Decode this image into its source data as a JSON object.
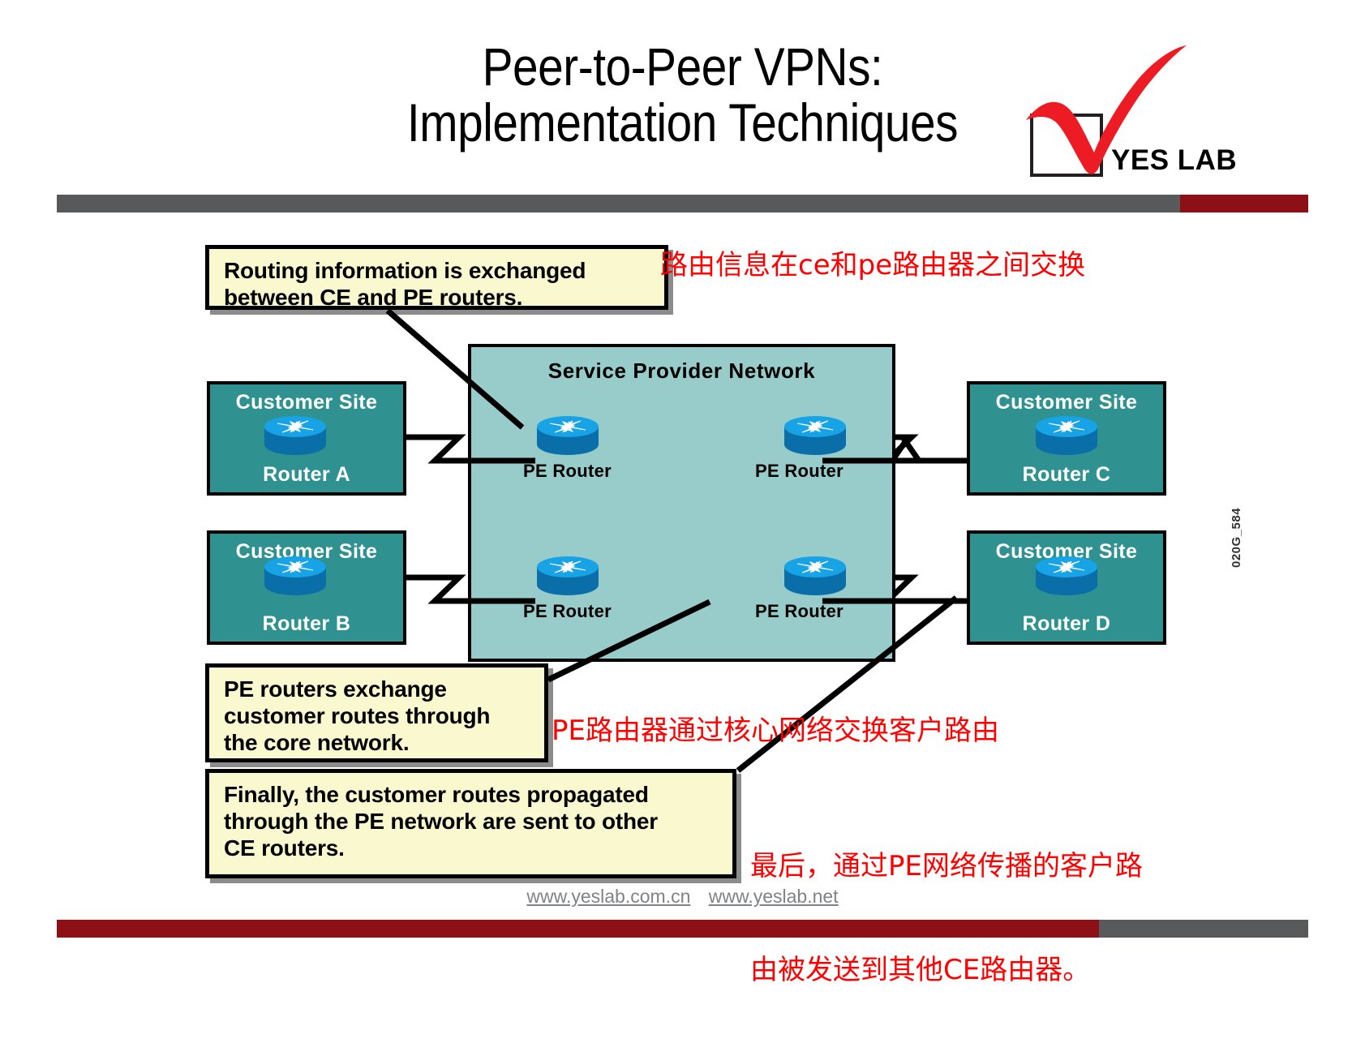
{
  "slide": {
    "title_line1": "Peer-to-Peer VPNs:",
    "title_line2": "Implementation Techniques",
    "side_code": "020G_584"
  },
  "logo": {
    "text": "YES LAB",
    "check_icon": "red-check-icon",
    "box_icon": "checkbox-square-icon",
    "accent_color": "#ed1c24"
  },
  "diagram": {
    "sp_network_label": "Service Provider Network",
    "customer_sites": [
      {
        "id": "a",
        "title": "Customer Site",
        "router": "Router A",
        "icon": "cisco-router-icon"
      },
      {
        "id": "b",
        "title": "Customer Site",
        "router": "Router B",
        "icon": "cisco-router-icon"
      },
      {
        "id": "c",
        "title": "Customer Site",
        "router": "Router C",
        "icon": "cisco-router-icon"
      },
      {
        "id": "d",
        "title": "Customer Site",
        "router": "Router D",
        "icon": "cisco-router-icon"
      }
    ],
    "pe_routers": [
      {
        "id": "pe1",
        "label": "PE Router",
        "icon": "cisco-router-icon"
      },
      {
        "id": "pe2",
        "label": "PE Router",
        "icon": "cisco-router-icon"
      },
      {
        "id": "pe3",
        "label": "PE Router",
        "icon": "cisco-router-icon"
      },
      {
        "id": "pe4",
        "label": "PE Router",
        "icon": "cisco-router-icon"
      }
    ],
    "colors": {
      "sp_network_fill": "#97cccb",
      "customer_site_fill": "#2f9290",
      "router_blue": "#0f8ed4",
      "callout_fill": "#f9f8cf"
    }
  },
  "callouts": {
    "one_line1": "Routing information is exchanged",
    "one_line2": "between CE and PE routers.",
    "two_line1": "PE routers exchange",
    "two_line2": "customer routes through",
    "two_line3": "the core network.",
    "three_line1": "Finally, the customer routes propagated",
    "three_line2": "through the PE network are sent to other",
    "three_line3": "CE routers."
  },
  "annotations_zh": {
    "one": "路由信息在ce和pe路由器之间交换",
    "two": "PE路由器通过核心网络交换客户路由",
    "three_line1": "最后，通过PE网络传播的客户路",
    "three_line2": "由被发送到其他CE路由器。"
  },
  "footer": {
    "link1": "www.yeslab.com.cn",
    "link2": "www.yeslab.net"
  }
}
